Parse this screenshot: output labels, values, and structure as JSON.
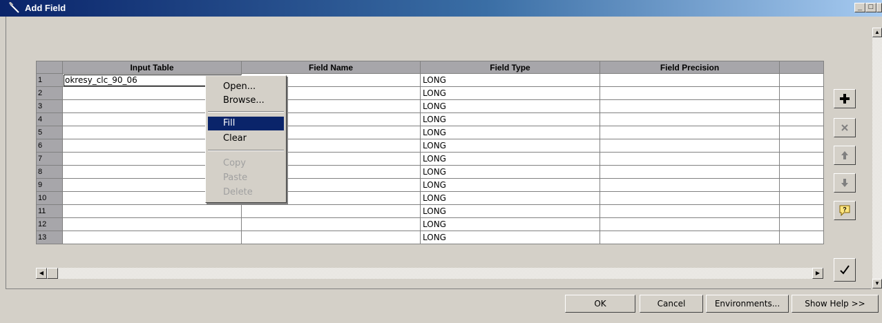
{
  "window": {
    "title": "Add Field",
    "minimize": "_",
    "maximize": "□",
    "close": "×"
  },
  "grid": {
    "columns": [
      "Input Table",
      "Field Name",
      "Field Type",
      "Field Precision",
      ""
    ],
    "rows": [
      {
        "num": "1",
        "input_table": "okresy_clc_90_06",
        "field_name": "",
        "field_type": "LONG",
        "field_precision": ""
      },
      {
        "num": "2",
        "input_table": "",
        "field_name": "",
        "field_type": "LONG",
        "field_precision": ""
      },
      {
        "num": "3",
        "input_table": "",
        "field_name": "",
        "field_type": "LONG",
        "field_precision": ""
      },
      {
        "num": "4",
        "input_table": "",
        "field_name": "",
        "field_type": "LONG",
        "field_precision": ""
      },
      {
        "num": "5",
        "input_table": "",
        "field_name": "",
        "field_type": "LONG",
        "field_precision": ""
      },
      {
        "num": "6",
        "input_table": "",
        "field_name": "",
        "field_type": "LONG",
        "field_precision": ""
      },
      {
        "num": "7",
        "input_table": "",
        "field_name": "",
        "field_type": "LONG",
        "field_precision": ""
      },
      {
        "num": "8",
        "input_table": "",
        "field_name": "",
        "field_type": "LONG",
        "field_precision": ""
      },
      {
        "num": "9",
        "input_table": "",
        "field_name": "",
        "field_type": "LONG",
        "field_precision": ""
      },
      {
        "num": "10",
        "input_table": "",
        "field_name": "",
        "field_type": "LONG",
        "field_precision": ""
      },
      {
        "num": "11",
        "input_table": "",
        "field_name": "",
        "field_type": "LONG",
        "field_precision": ""
      },
      {
        "num": "12",
        "input_table": "",
        "field_name": "",
        "field_type": "LONG",
        "field_precision": ""
      },
      {
        "num": "13",
        "input_table": "",
        "field_name": "",
        "field_type": "LONG",
        "field_precision": ""
      }
    ]
  },
  "context_menu": {
    "open": "Open...",
    "browse": "Browse...",
    "fill": "Fill",
    "clear": "Clear",
    "copy": "Copy",
    "paste": "Paste",
    "delete": "Delete"
  },
  "side_buttons": {
    "add": "plus-icon",
    "remove": "x-icon",
    "move_up": "arrow-up-icon",
    "move_down": "arrow-down-icon",
    "help": "help-icon",
    "check": "check-icon"
  },
  "buttons": {
    "ok": "OK",
    "cancel": "Cancel",
    "environments": "Environments...",
    "show_help": "Show Help >>"
  },
  "colors": {
    "title_start": "#0a246a",
    "title_end": "#a6caf0",
    "highlight": "#0a246a",
    "face": "#d4d0c8"
  }
}
